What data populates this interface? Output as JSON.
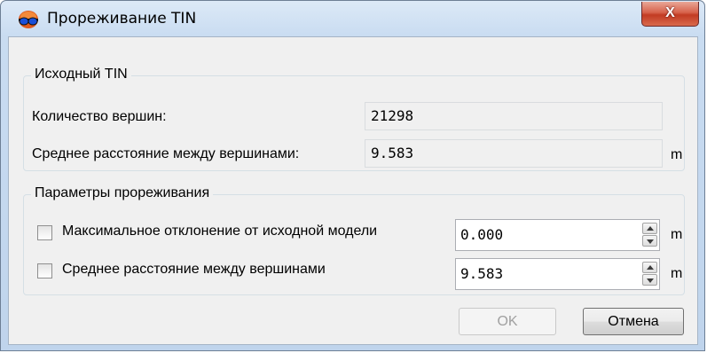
{
  "window": {
    "title": "Прореживание TIN",
    "app_icon": "tin-glasses-icon",
    "close_label": "X",
    "accent_color": "#c23b23"
  },
  "source_group": {
    "title": "Исходный TIN",
    "vertex_count_label": "Количество вершин:",
    "vertex_count_value": "21298",
    "avg_distance_label": "Среднее расстояние между вершинами:",
    "avg_distance_value": "9.583",
    "avg_distance_unit": "m"
  },
  "params_group": {
    "title": "Параметры прореживания",
    "max_deviation": {
      "label": "Максимальное отклонение от исходной модели",
      "checked": false,
      "value": "0.000",
      "unit": "m"
    },
    "avg_distance": {
      "label": "Среднее расстояние между вершинами",
      "checked": false,
      "value": "9.583",
      "unit": "m"
    }
  },
  "buttons": {
    "ok_label": "OK",
    "ok_enabled": false,
    "cancel_label": "Отмена"
  }
}
